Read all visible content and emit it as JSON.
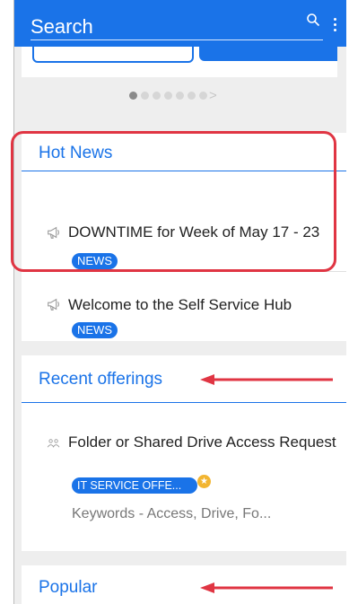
{
  "header": {
    "search_label": "Search",
    "search_icon": "search-icon",
    "menu_icon": "more-vert-icon",
    "color": "#1a73e8"
  },
  "carousel": {
    "page_count": 7,
    "active_index": 0,
    "next_glyph": ">"
  },
  "hot_news": {
    "title": "Hot News",
    "items": [
      {
        "icon": "megaphone-icon",
        "text": "DOWNTIME for Week of May 17 - 23",
        "badge": "NEWS"
      },
      {
        "icon": "megaphone-icon",
        "text": "Welcome to the Self Service Hub",
        "badge": "NEWS"
      }
    ]
  },
  "recent_offerings": {
    "title": "Recent offerings",
    "items": [
      {
        "icon": "people-icon",
        "title": "Folder or Shared Drive Access Request",
        "badge": "IT SERVICE OFFE...",
        "favorite_icon": "star-icon",
        "keywords": "Keywords - Access, Drive, Fo..."
      }
    ]
  },
  "popular": {
    "title": "Popular"
  },
  "annotations": {
    "highlight_color": "#e03543"
  }
}
